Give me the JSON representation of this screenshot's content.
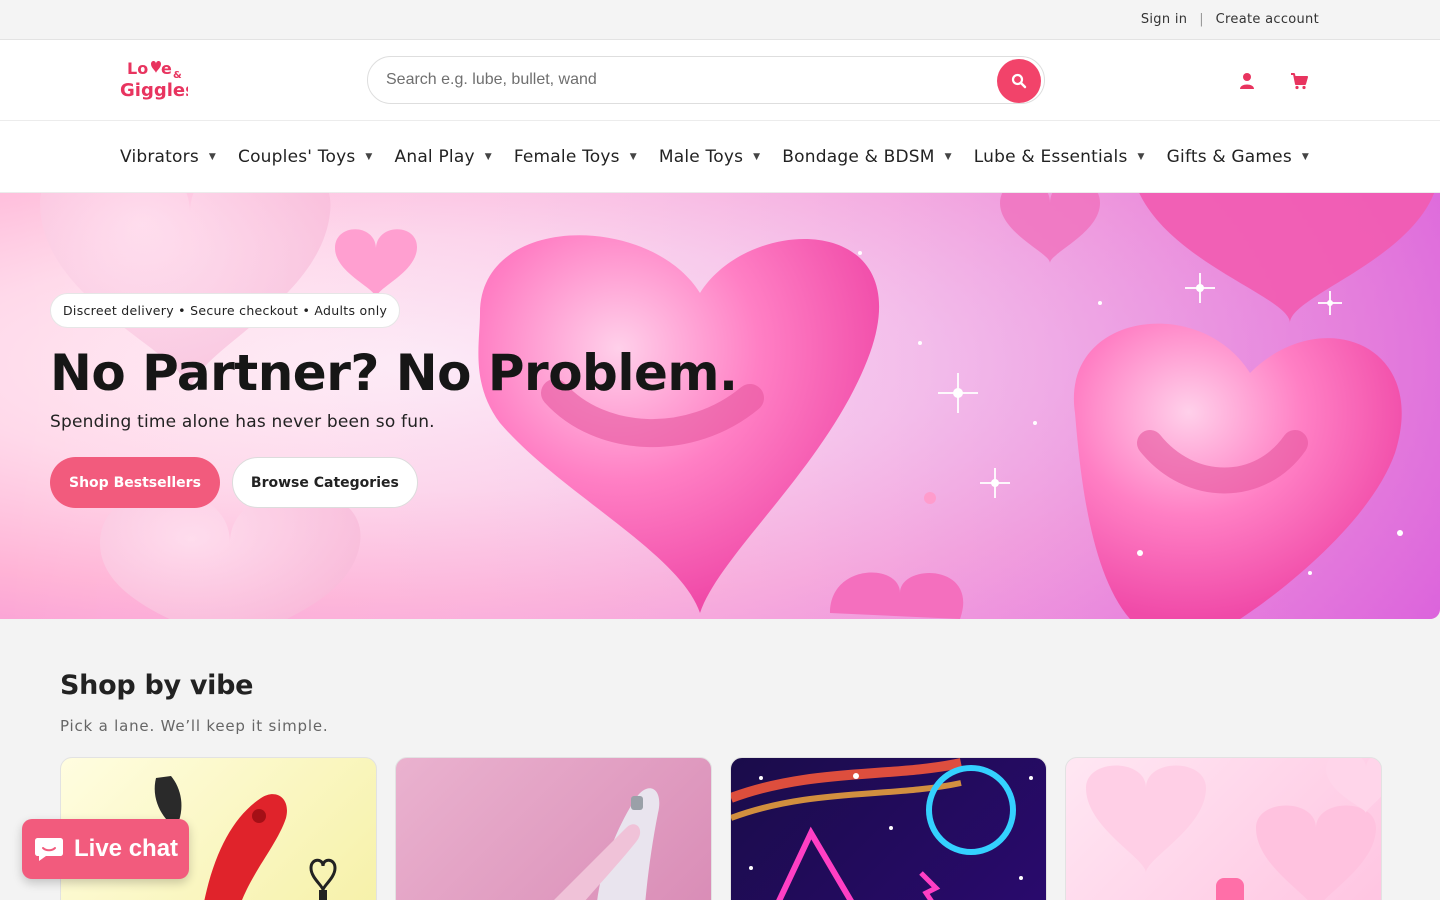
{
  "utility": {
    "sign_in": "Sign in",
    "separator": "|",
    "create_account": "Create account"
  },
  "header": {
    "logo_line1": "Love",
    "logo_amp": "&",
    "logo_line2": "Giggles",
    "search_placeholder": "Search e.g. lube, bullet, wand",
    "account_icon": "user-icon",
    "cart_icon": "cart-icon"
  },
  "nav": {
    "items": [
      {
        "label": "Vibrators"
      },
      {
        "label": "Couples' Toys"
      },
      {
        "label": "Anal Play"
      },
      {
        "label": "Female Toys"
      },
      {
        "label": "Male Toys"
      },
      {
        "label": "Bondage & BDSM"
      },
      {
        "label": "Lube & Essentials"
      },
      {
        "label": "Gifts & Games"
      }
    ]
  },
  "hero": {
    "pill": "Discreet delivery • Secure checkout • Adults only",
    "title": "No Partner? No Problem.",
    "subtitle": "Spending time alone has never been so fun.",
    "primary_button": "Shop Bestsellers",
    "secondary_button": "Browse Categories"
  },
  "section": {
    "title": "Shop by vibe",
    "subtitle": "Pick a lane. We’ll keep it simple."
  },
  "live_chat": {
    "label": "Live chat"
  },
  "colors": {
    "accent": "#f25b7d",
    "search_button": "#f2436a",
    "logo_pink": "#e8345f"
  }
}
